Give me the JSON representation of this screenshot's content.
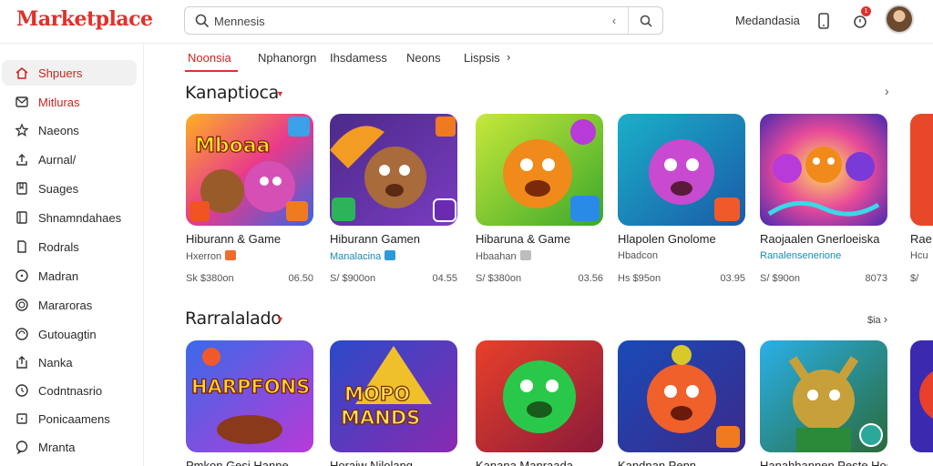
{
  "header": {
    "logo": "Marketplace",
    "search_value": "Mennesis",
    "user_label": "Medandasia",
    "notification_count": "1"
  },
  "sidebar": {
    "items": [
      {
        "label": "Shpuers",
        "icon": "home-icon",
        "active": true
      },
      {
        "label": "Mitluras",
        "icon": "mail-icon",
        "red": true
      },
      {
        "label": "Naeons",
        "icon": "star-icon"
      },
      {
        "label": "Aurnal/",
        "icon": "upload-icon"
      },
      {
        "label": "Suages",
        "icon": "bookmark-icon"
      },
      {
        "label": "Shnamndahaes",
        "icon": "book-icon"
      },
      {
        "label": "Rodrals",
        "icon": "document-icon"
      },
      {
        "label": "Madran",
        "icon": "clock-icon"
      },
      {
        "label": "Mararoras",
        "icon": "target-icon"
      },
      {
        "label": "Gutouagtin",
        "icon": "globe-icon"
      },
      {
        "label": "Nanka",
        "icon": "share-icon"
      },
      {
        "label": "Codntnasrio",
        "icon": "clock-icon"
      },
      {
        "label": "Ponicaamens",
        "icon": "square-icon"
      },
      {
        "label": "Mranta",
        "icon": "chat-icon"
      }
    ]
  },
  "tabs": [
    "Noonsia",
    "Nphanorgn",
    "Ihsdamess",
    "Neons",
    "Lispsis"
  ],
  "sections": [
    {
      "title": "Kanaptioca",
      "cards": [
        {
          "title": "Hiburann & Game",
          "sub": "Hxerron",
          "price": "Sk $380on",
          "score": "06.50"
        },
        {
          "title": "Hiburann Gamen",
          "sub": "Manalacina",
          "price": "S/ $900on",
          "score": "04.55"
        },
        {
          "title": "Hibaruna & Game",
          "sub": "Hbaahan",
          "price": "S/ $380on",
          "score": "03.56"
        },
        {
          "title": "Hlapolen Gnolome",
          "sub": "Hbadcon",
          "price": "Hs $95on",
          "score": "03.95"
        },
        {
          "title": "Raojaalen Gnerloeiska",
          "sub": "Ranalensenerione",
          "price": "S/ $90on",
          "score": "8073"
        },
        {
          "title": "Rae",
          "sub": "Hcu",
          "price": "$/",
          "score": ""
        }
      ]
    },
    {
      "title": "Rarralalado",
      "see_all": "$ia",
      "cards": [
        {
          "title": "Pmkon Gesi Hanne"
        },
        {
          "title": "Horaiw Nilolang"
        },
        {
          "title": "Kanana Manraada"
        },
        {
          "title": "Kandnan Penn"
        },
        {
          "title": "Hanahhannen Peste Hosane"
        },
        {
          "title": ""
        }
      ]
    }
  ]
}
